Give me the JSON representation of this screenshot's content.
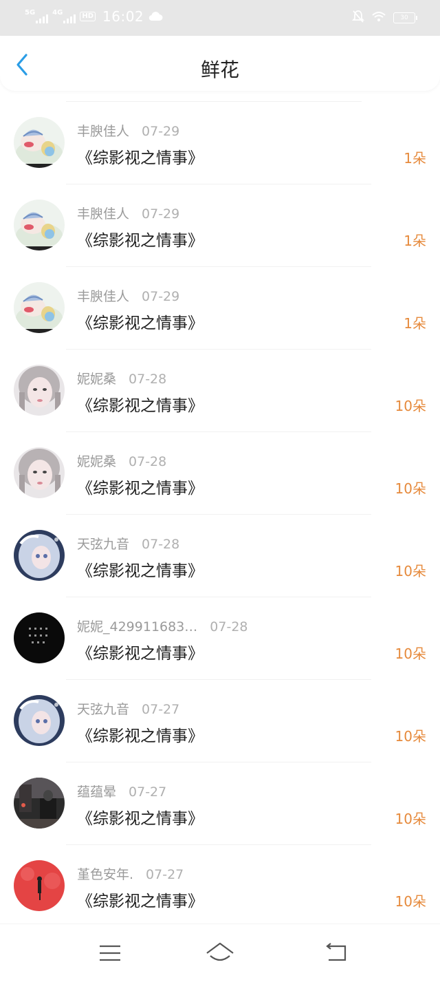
{
  "status_bar": {
    "network1": "5G",
    "network2": "4G",
    "hd_label": "HD",
    "time": "16:02",
    "battery": "30"
  },
  "header": {
    "title": "鲜花"
  },
  "items": [
    {
      "user": "丰腴佳人",
      "date": "07-29",
      "book": "《综影视之情事》",
      "count": "1朵",
      "avatar": "cartoon"
    },
    {
      "user": "丰腴佳人",
      "date": "07-29",
      "book": "《综影视之情事》",
      "count": "1朵",
      "avatar": "cartoon"
    },
    {
      "user": "丰腴佳人",
      "date": "07-29",
      "book": "《综影视之情事》",
      "count": "1朵",
      "avatar": "cartoon"
    },
    {
      "user": "妮妮桑",
      "date": "07-28",
      "book": "《综影视之情事》",
      "count": "10朵",
      "avatar": "girl"
    },
    {
      "user": "妮妮桑",
      "date": "07-28",
      "book": "《综影视之情事》",
      "count": "10朵",
      "avatar": "girl"
    },
    {
      "user": "天弦九音",
      "date": "07-28",
      "book": "《综影视之情事》",
      "count": "10朵",
      "avatar": "anime"
    },
    {
      "user": "妮妮_429911683…",
      "date": "07-28",
      "book": "《综影视之情事》",
      "count": "10朵",
      "avatar": "dark"
    },
    {
      "user": "天弦九音",
      "date": "07-27",
      "book": "《综影视之情事》",
      "count": "10朵",
      "avatar": "anime"
    },
    {
      "user": "蕴蕴晕",
      "date": "07-27",
      "book": "《综影视之情事》",
      "count": "10朵",
      "avatar": "night"
    },
    {
      "user": "堇色安年.",
      "date": "07-27",
      "book": "《综影视之情事》",
      "count": "10朵",
      "avatar": "red"
    }
  ],
  "nav": {
    "menu_icon": "menu-icon",
    "home_icon": "home-icon",
    "back_icon": "back-icon"
  },
  "colors": {
    "accent": "#2b9de6",
    "count": "#e68a3c",
    "status_bar": "#e7e7e7"
  }
}
